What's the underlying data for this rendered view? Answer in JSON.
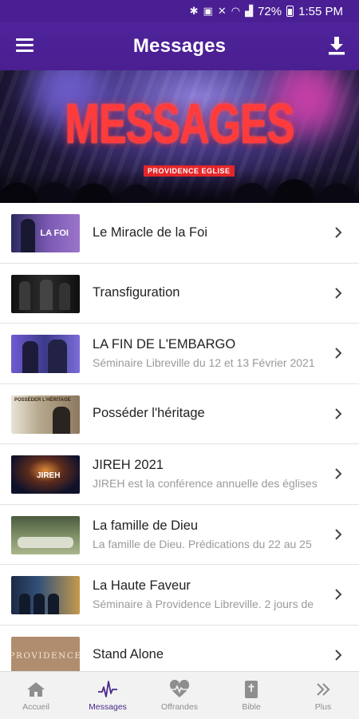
{
  "status_bar": {
    "battery": "72%",
    "time": "1:55 PM"
  },
  "header": {
    "title": "Messages"
  },
  "hero": {
    "title": "MESSAGES",
    "badge": "PROVIDENCE EGLISE"
  },
  "messages": [
    {
      "title": "Le Miracle de la Foi",
      "subtitle": ""
    },
    {
      "title": "Transfiguration",
      "subtitle": ""
    },
    {
      "title": "LA FIN DE L'EMBARGO",
      "subtitle": "Séminaire Libreville du 12 et 13 Février 2021"
    },
    {
      "title": "Posséder l'héritage",
      "subtitle": ""
    },
    {
      "title": "JIREH 2021",
      "subtitle": "JIREH est la conférence annuelle des églises"
    },
    {
      "title": "La famille de Dieu",
      "subtitle": "La famille de Dieu. Prédications du 22 au 25"
    },
    {
      "title": "La Haute Faveur",
      "subtitle": "Séminaire à Providence Libreville. 2 jours de"
    },
    {
      "title": "Stand Alone",
      "subtitle": ""
    }
  ],
  "thumbnail_texts": {
    "t1": "LA FOI",
    "t4": "POSSÉDER L'HÉRITAGE",
    "t5": "JIREH",
    "t8": "PROVIDENCE"
  },
  "bottom_nav": [
    {
      "label": "Accueil",
      "icon": "home-icon"
    },
    {
      "label": "Messages",
      "icon": "waveform-icon",
      "active": true
    },
    {
      "label": "Offrandes",
      "icon": "heart-pulse-icon"
    },
    {
      "label": "Bible",
      "icon": "bible-icon"
    },
    {
      "label": "Plus",
      "icon": "double-chevron-icon"
    }
  ],
  "colors": {
    "primary": "#4a1f91",
    "hero_title": "#ff3b3b",
    "active_nav": "#4a2a8a"
  }
}
